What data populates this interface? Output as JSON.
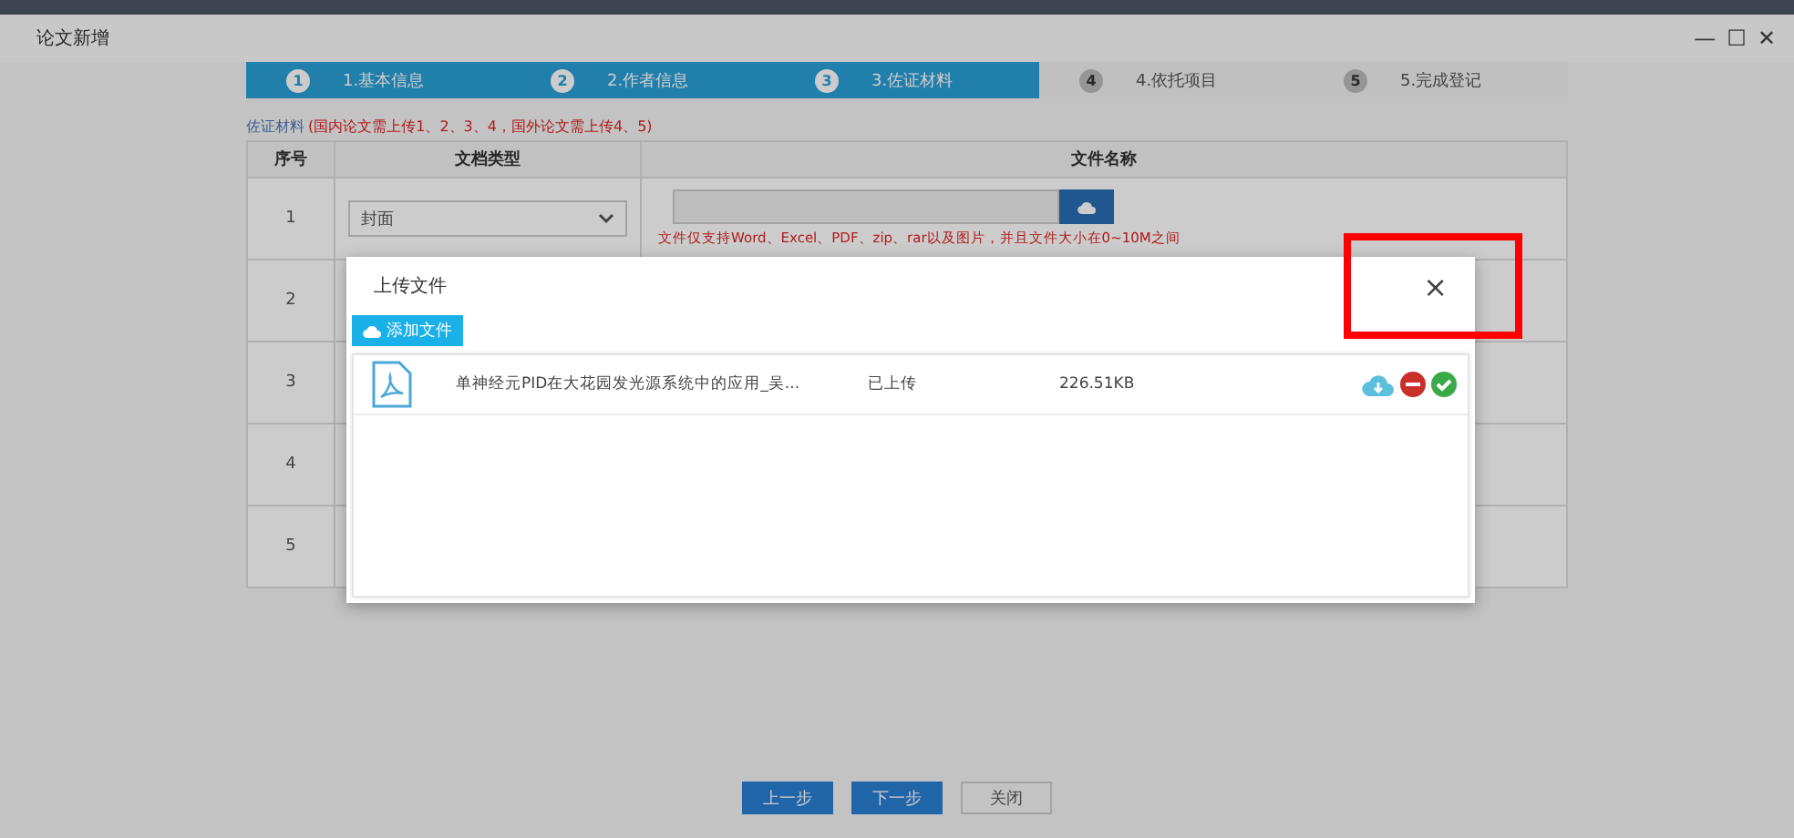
{
  "window": {
    "title": "论文新增",
    "controls": [
      "—",
      "☐",
      "✕"
    ]
  },
  "steps": [
    {
      "number": "1",
      "label": "1.基本信息",
      "active": true
    },
    {
      "number": "2",
      "label": "2.作者信息",
      "active": true
    },
    {
      "number": "3",
      "label": "3.佐证材料",
      "active": true
    },
    {
      "number": "4",
      "label": "4.依托项目",
      "active": false
    },
    {
      "number": "5",
      "label": "5.完成登记",
      "active": false
    }
  ],
  "section": {
    "title": "佐证材料",
    "note": "(国内论文需上传1、2、3、4，国外论文需上传4、5)"
  },
  "table": {
    "columns": [
      "序号",
      "文档类型",
      "文件名称"
    ],
    "rows": [
      {
        "index": "1",
        "doc_type": "封面",
        "hint": "文件仅支持Word、Excel、PDF、zip、rar以及图片，并且文件大小在0~10M之间"
      },
      {
        "index": "2"
      },
      {
        "index": "3"
      },
      {
        "index": "4"
      },
      {
        "index": "5"
      }
    ]
  },
  "dialog": {
    "title": "上传文件",
    "close": "×",
    "add_button": "添加文件",
    "files": [
      {
        "name": "单神经元PID在大花园发光源系统中的应用_吴...",
        "status": "已上传",
        "size": "226.51KB"
      }
    ]
  },
  "buttons": [
    {
      "label": "上一步",
      "kind": "primary"
    },
    {
      "label": "下一步",
      "kind": "primary"
    },
    {
      "label": "关闭",
      "kind": "plain"
    }
  ]
}
